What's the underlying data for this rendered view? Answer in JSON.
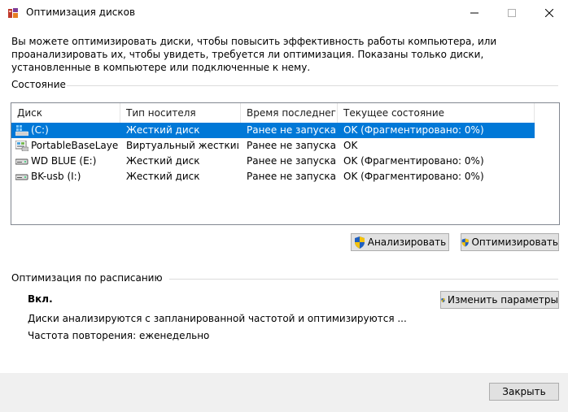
{
  "window": {
    "title": "Оптимизация дисков",
    "minimize_icon": "minimize-icon",
    "maximize_icon": "maximize-icon",
    "close_icon": "close-icon"
  },
  "description": "Вы можете оптимизировать диски, чтобы повысить эффективность работы  компьютера, или проанализировать их, чтобы увидеть, требуется ли оптимизация. Показаны только диски, установленные в компьютере или подключенные к нему.",
  "status": {
    "group_label": "Состояние",
    "columns": [
      "Диск",
      "Тип носителя",
      "Время последнег...",
      "Текущее состояние"
    ],
    "rows": [
      {
        "drive": "(C:)",
        "media": "Жесткий диск",
        "last_run": "Ранее не запуска...",
        "state": "OK (Фрагментировано: 0%)",
        "icon": "system-drive-icon",
        "selected": true
      },
      {
        "drive": "PortableBaseLayer ...",
        "media": "Виртуальный жесткий ...",
        "last_run": "Ранее не запуска...",
        "state": "OK",
        "icon": "virtual-drive-icon",
        "selected": false
      },
      {
        "drive": "WD BLUE (E:)",
        "media": "Жесткий диск",
        "last_run": "Ранее не запуска...",
        "state": "OK (Фрагментировано: 0%)",
        "icon": "hard-drive-icon",
        "selected": false
      },
      {
        "drive": "BK-usb (I:)",
        "media": "Жесткий диск",
        "last_run": "Ранее не запуска...",
        "state": "OK (Фрагментировано: 0%)",
        "icon": "hard-drive-icon",
        "selected": false
      }
    ],
    "analyze_label": "Анализировать",
    "optimize_label": "Оптимизировать"
  },
  "schedule": {
    "group_label": "Оптимизация по расписанию",
    "state": "Вкл.",
    "details": "Диски анализируются с запланированной частотой и оптимизируются ...",
    "frequency": "Частота повторения: еженедельно",
    "change_label": "Изменить параметры"
  },
  "footer": {
    "close_label": "Закрыть"
  },
  "colors": {
    "selection": "#0078d7",
    "button_bg": "#e1e1e1",
    "footer_bg": "#f0f0f0"
  }
}
